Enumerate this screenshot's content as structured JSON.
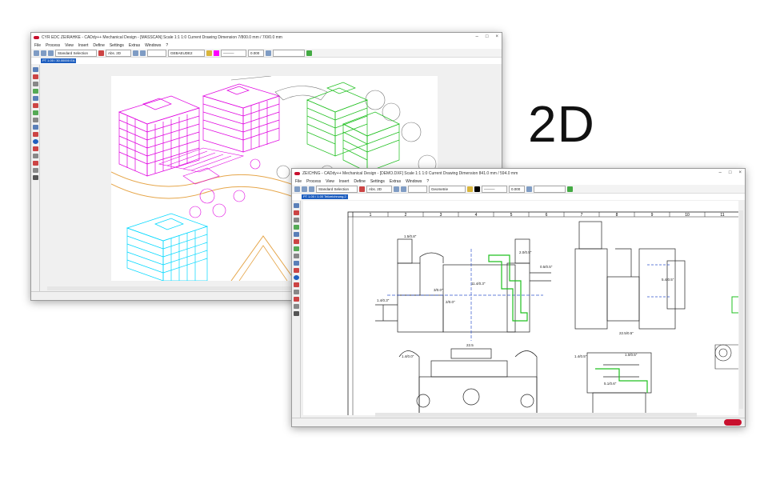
{
  "heading": "2D",
  "window1": {
    "title": "CYR EDC ZEIRAHKE - CADdy++ Mechanical Design - [MASSCAN]   Scale 1:1   1:0   Current Drawing Dimension 7/800.0 mm / 7/0/0.0 mm",
    "menu": [
      "File",
      "Process",
      "View",
      "Insert",
      "Define",
      "Settings",
      "Extras",
      "Windows",
      "?"
    ],
    "selection": "Standard Selection",
    "style": "Abs. 2D",
    "layer": "GEBAEUDE2",
    "value": "0.000",
    "command": "PT 1.00 / 30.00000 EA"
  },
  "window2": {
    "title": "ZEICHNG - CADdy++ Mechanical Design - [DEMO.DXF]   Scale 1:1   1:0   Current Drawing Dimension 841.0 mm / 594.0 mm",
    "menu": [
      "File",
      "Process",
      "View",
      "Insert",
      "Define",
      "Settings",
      "Extras",
      "Windows",
      "?"
    ],
    "selection": "Standard Selection",
    "style": "Abs. 2D",
    "layer": "Geometrie",
    "value": "0.000",
    "command": "PT 1.00 / 1.00 Teilzeichnung.2"
  },
  "ruler_numbers": [
    "1",
    "2",
    "3",
    "4",
    "5",
    "6",
    "7",
    "8",
    "9",
    "10",
    "11"
  ],
  "dimensions": [
    "1.5/0.8\"",
    "22.5",
    "2.0/0.5\"",
    "1.4/0.3\"",
    "11.4/0.3\"",
    "3/0.0\"",
    "2/0.0\"",
    "0.5/0.5\"",
    "1.4/0.0\"",
    "1.4/0.5\"",
    "5.1/0.6\"",
    "5.4/0.5\"",
    "22.5/0.5\"",
    "1.0/0.5\""
  ],
  "colors": {
    "accent": "#c8102e",
    "magenta": "#e000e0",
    "green": "#20c020",
    "cyan": "#00d8ff",
    "orange": "#e6a64a"
  }
}
